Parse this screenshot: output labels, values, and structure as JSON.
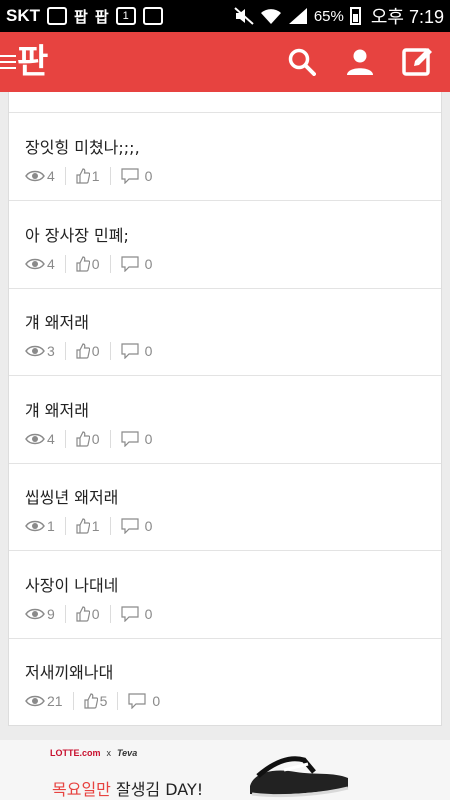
{
  "status_bar": {
    "carrier": "SKT",
    "notify_glyph_1": "팝",
    "notify_glyph_2": "팝",
    "notify_glyph_3": "1",
    "battery": "65%",
    "time": "오후 7:19"
  },
  "app_bar": {
    "logo": "판",
    "accent": "#e74340",
    "icons": [
      "menu-icon",
      "search-icon",
      "user-icon",
      "write-icon"
    ]
  },
  "posts": [
    {
      "title": "장잇힝 미쳤나;;;,",
      "views": "4",
      "likes": "1",
      "comments": "0"
    },
    {
      "title": "아 장사장 민폐;",
      "views": "4",
      "likes": "0",
      "comments": "0"
    },
    {
      "title": "걔 왜저래",
      "views": "3",
      "likes": "0",
      "comments": "0"
    },
    {
      "title": "걔 왜저래",
      "views": "4",
      "likes": "0",
      "comments": "0"
    },
    {
      "title": "씹씽년 왜저래",
      "views": "1",
      "likes": "1",
      "comments": "0"
    },
    {
      "title": "사장이 나대네",
      "views": "9",
      "likes": "0",
      "comments": "0"
    },
    {
      "title": "저새끼왜나대",
      "views": "21",
      "likes": "5",
      "comments": "0"
    }
  ],
  "ad": {
    "brand_1": "LOTTE.com",
    "brand_x": "x",
    "brand_2": "Teva",
    "headline_red": "목요일만",
    "headline_rest": " 잘생김 DAY!"
  }
}
